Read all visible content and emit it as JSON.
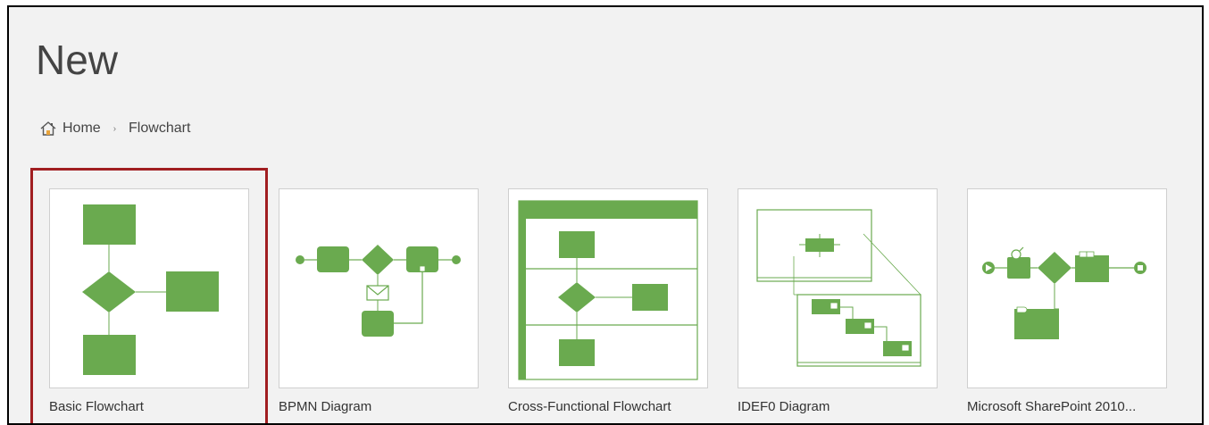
{
  "page": {
    "title": "New"
  },
  "breadcrumb": {
    "home_label": "Home",
    "separator": "›",
    "current_label": "Flowchart"
  },
  "templates": [
    {
      "label": "Basic Flowchart",
      "selected": true,
      "icon": "basic-flowchart-thumbnail"
    },
    {
      "label": "BPMN Diagram",
      "selected": false,
      "icon": "bpmn-diagram-thumbnail"
    },
    {
      "label": "Cross-Functional Flowchart",
      "selected": false,
      "icon": "cross-functional-flowchart-thumbnail"
    },
    {
      "label": "IDEF0 Diagram",
      "selected": false,
      "icon": "idef0-diagram-thumbnail"
    },
    {
      "label": "Microsoft SharePoint 2010...",
      "selected": false,
      "icon": "sharepoint-workflow-thumbnail"
    }
  ],
  "colors": {
    "shape_fill": "#6aaa4f",
    "line": "#6aaa4f",
    "selection_border": "#a11e21",
    "background": "#f2f2f2"
  }
}
